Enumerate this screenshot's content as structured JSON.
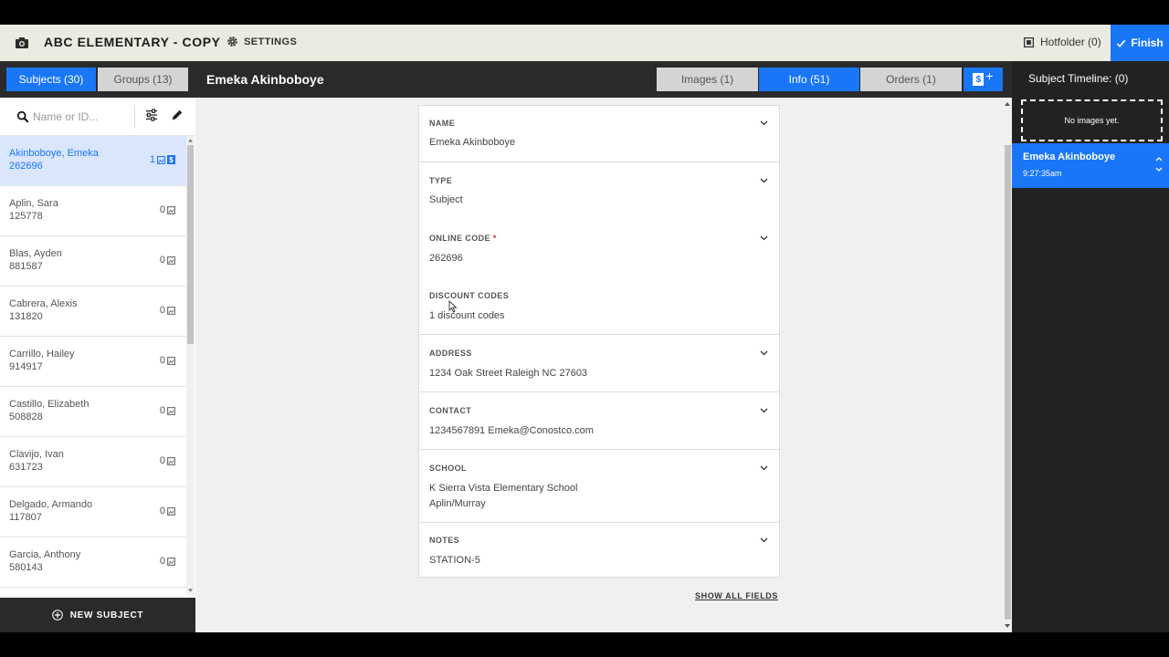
{
  "app": {
    "title": "ABC ELEMENTARY - COPY",
    "settings_label": "SETTINGS",
    "hotfolder_label": "Hotfolder (0)",
    "finish_label": "Finish"
  },
  "tabs": {
    "subjects": "Subjects (30)",
    "groups": "Groups (13)",
    "images": "Images (1)",
    "info": "Info (51)",
    "orders": "Orders (1)"
  },
  "current_subject": "Emeka Akinboboye",
  "search": {
    "placeholder": "Name or ID..."
  },
  "subjects": [
    {
      "name": "Akinboboye, Emeka",
      "code": "262696",
      "count": "1",
      "selected": true
    },
    {
      "name": "Aplin, Sara",
      "code": "125778",
      "count": "0"
    },
    {
      "name": "Blas, Ayden",
      "code": "881587",
      "count": "0"
    },
    {
      "name": "Cabrera, Alexis",
      "code": "131820",
      "count": "0"
    },
    {
      "name": "Carrillo, Hailey",
      "code": "914917",
      "count": "0"
    },
    {
      "name": "Castillo, Elizabeth",
      "code": "508828",
      "count": "0"
    },
    {
      "name": "Clavijo, Ivan",
      "code": "631723",
      "count": "0"
    },
    {
      "name": "Delgado, Armando",
      "code": "117807",
      "count": "0"
    },
    {
      "name": "Garcia, Anthony",
      "code": "580143",
      "count": "0"
    }
  ],
  "new_subject_label": "NEW SUBJECT",
  "fields": {
    "name": {
      "label": "NAME",
      "value": "Emeka Akinboboye"
    },
    "type": {
      "label": "TYPE",
      "value": "Subject"
    },
    "online_code": {
      "label": "ONLINE CODE",
      "required_mark": "*",
      "value": "262696"
    },
    "discount_codes": {
      "label": "DISCOUNT CODES",
      "value": "1 discount codes"
    },
    "address": {
      "label": "ADDRESS",
      "value": "1234 Oak Street   Raleigh   NC   27603"
    },
    "contact": {
      "label": "CONTACT",
      "value": "1234567891   Emeka@Conostco.com"
    },
    "school": {
      "label": "SCHOOL",
      "value": "K   Sierra Vista Elementary School",
      "value2": "Aplin/Murray"
    },
    "notes": {
      "label": "NOTES",
      "value": "STATION-5"
    }
  },
  "show_all_fields": "SHOW ALL FIELDS",
  "timeline": {
    "title": "Subject Timeline: (0)",
    "no_images": "No images yet.",
    "entry_name": "Emeka Akinboboye",
    "entry_time": "9:27:35am"
  },
  "colors": {
    "accent": "#1976f7",
    "topbar": "#ecebe2",
    "dark": "#2a2a2a",
    "selected_row": "#d9e6fb"
  },
  "icons": [
    "camera-icon",
    "gear-icon",
    "hotfolder-icon",
    "check-icon",
    "search-icon",
    "filter-icon",
    "edit-icon",
    "image-icon",
    "dollar-icon",
    "plus-icon",
    "chevron-down-icon",
    "chevron-up-icon"
  ]
}
